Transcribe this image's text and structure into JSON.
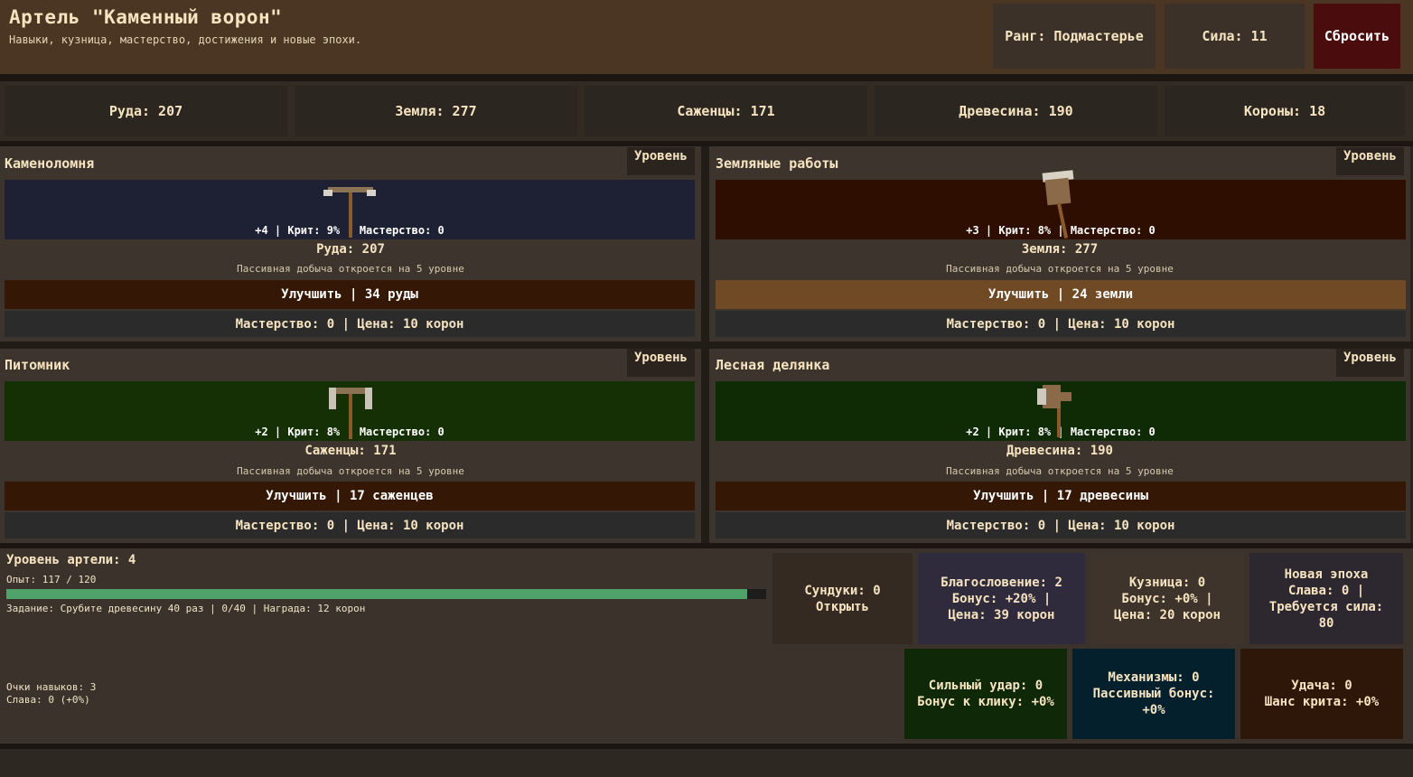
{
  "header": {
    "title": "Артель \"Каменный ворон\"",
    "subtitle": "Навыки, кузница, мастерство, достижения и новые эпохи.",
    "rank": "Ранг: Подмастерье",
    "power": "Сила: 11",
    "reset_label": "Сбросить"
  },
  "resources": [
    {
      "label": "Руда: 207"
    },
    {
      "label": "Земля: 277"
    },
    {
      "label": "Саженцы: 171"
    },
    {
      "label": "Древесина: 190"
    },
    {
      "label": "Короны: 18"
    }
  ],
  "panels": [
    {
      "title": "Каменоломня",
      "level_label": "Уровень",
      "stats": "+4 | Крит: 9% | Мастерство: 0",
      "resource": "Руда: 207",
      "passive": "Пассивная добыча откроется на 5 уровне",
      "upgrade": "Улучшить | 34 руды",
      "mastery": "Мастерство: 0 | Цена: 10 корон",
      "tool_icon": "pickaxe-icon",
      "scene_color": "#1e2134",
      "upgrade_color": "#341705"
    },
    {
      "title": "Земляные работы",
      "level_label": "Уровень",
      "stats": "+3 | Крит: 8% | Мастерство: 0",
      "resource": "Земля: 277",
      "passive": "Пассивная добыча откроется на 5 уровне",
      "upgrade": "Улучшить | 24 земли",
      "mastery": "Мастерство: 0 | Цена: 10 корон",
      "tool_icon": "shovel-icon",
      "scene_color": "#2f0e02",
      "upgrade_color": "#6f4a25"
    },
    {
      "title": "Питомник",
      "level_label": "Уровень",
      "stats": "+2 | Крит: 8% | Мастерство: 0",
      "resource": "Саженцы: 171",
      "passive": "Пассивная добыча откроется на 5 уровне",
      "upgrade": "Улучшить | 17 саженцев",
      "mastery": "Мастерство: 0 | Цена: 10 корон",
      "tool_icon": "hoe-icon",
      "scene_color": "#143004",
      "upgrade_color": "#341705"
    },
    {
      "title": "Лесная делянка",
      "level_label": "Уровень",
      "stats": "+2 | Крит: 8% | Мастерство: 0",
      "resource": "Древесина: 190",
      "passive": "Пассивная добыча откроется на 5 уровне",
      "upgrade": "Улучшить | 17 древесины",
      "mastery": "Мастерство: 0 | Цена: 10 корон",
      "tool_icon": "axe-icon",
      "scene_color": "#0e2b06",
      "upgrade_color": "#341705"
    }
  ],
  "guild": {
    "level": "Уровень артели: 4",
    "xp": "Опыт: 117 / 120",
    "xp_progress": 0.975,
    "task": "Задание: Срубите древесину 40 раз | 0/40 | Награда: 12 корон",
    "skill_points": "Очки навыков: 3",
    "fame": "Слава: 0 (+0%)"
  },
  "cards": {
    "chests": [
      "Сундуки: 0",
      "Открыть"
    ],
    "blessing": [
      "Благословение: 2",
      "Бонус: +20% |",
      "Цена: 39 корон"
    ],
    "forge": [
      "Кузница: 0",
      "Бонус: +0% |",
      "Цена: 20 корон"
    ],
    "new_era": [
      "Новая эпоха",
      "Слава: 0 |",
      "Требуется сила:",
      "80"
    ],
    "strong_hit": [
      "Сильный удар: 0",
      "Бонус к клику: +0%"
    ],
    "mechanisms": [
      "Механизмы: 0",
      "Пассивный бонус:",
      "+0%"
    ],
    "luck": [
      "Удача: 0",
      "Шанс крита: +0%"
    ]
  },
  "colors": {
    "progress_fill": "#4fa36a",
    "progress_track": "#1d1d1d"
  }
}
